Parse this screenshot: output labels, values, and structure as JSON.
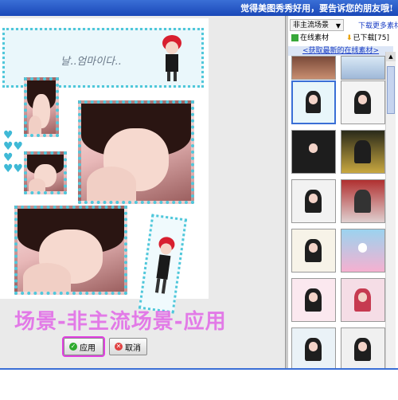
{
  "topbar": {
    "marquee": "觉得美图秀秀好用，要告诉您的朋友哦!"
  },
  "canvas": {
    "banner_text": "날..엄마이다..",
    "caption": "场景-非主流场景-应用"
  },
  "buttons": {
    "apply": "应用",
    "cancel": "取消"
  },
  "right": {
    "dropdown": "非主流场景",
    "more_link": "下载更多素材",
    "tab_online": "在线素材",
    "tab_downloaded": "已下载[75]",
    "latest_link": "<获取最新的在线素材>"
  },
  "colors": {
    "accent": "#3a6fd6",
    "frame": "#50c8dc",
    "caption": "#e27ae7"
  }
}
